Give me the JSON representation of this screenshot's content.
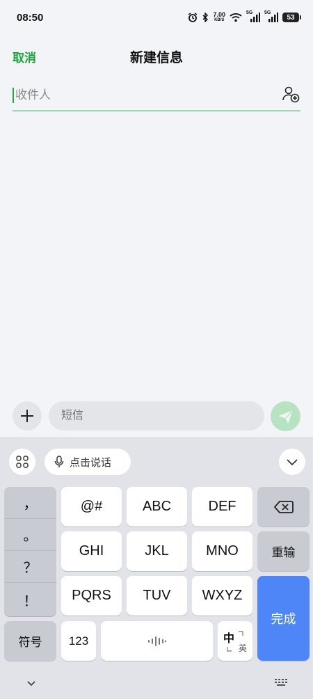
{
  "status_bar": {
    "time": "08:50",
    "net_speed_value": "7.00",
    "net_speed_unit": "KB/S",
    "signal1_label": "5G",
    "signal2_label": "5G",
    "battery": "53"
  },
  "header": {
    "cancel_label": "取消",
    "title": "新建信息"
  },
  "recipient": {
    "placeholder": "收件人"
  },
  "compose": {
    "placeholder": "短信"
  },
  "keyboard": {
    "voice_label": "点击说话",
    "punctuation": [
      "，",
      "。",
      "？",
      "！"
    ],
    "rows": [
      [
        "@#",
        "ABC",
        "DEF"
      ],
      [
        "GHI",
        "JKL",
        "MNO"
      ],
      [
        "PQRS",
        "TUV",
        "WXYZ"
      ]
    ],
    "delete_label": "",
    "reenter_label": "重输",
    "symbols_label": "符号",
    "numbers_label": "123",
    "lang_main": "中",
    "lang_sub": "英",
    "done_label": "完成"
  }
}
